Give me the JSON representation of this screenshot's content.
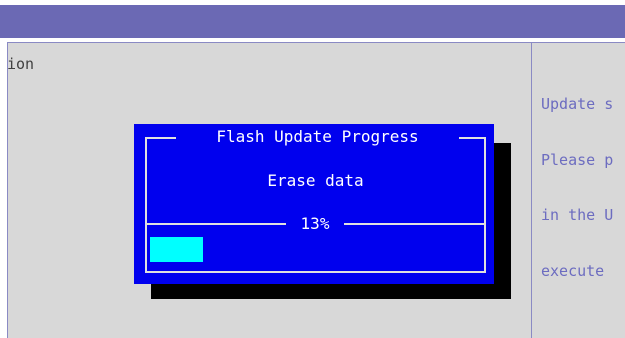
{
  "background_text": {
    "left": "ion",
    "help_lines": [
      "Update s",
      "Please p",
      "in the U",
      "execute "
    ]
  },
  "dialog": {
    "title": "Flash Update Progress",
    "message": "Erase data",
    "percent_label": "13%",
    "progress_fraction": 0.16
  },
  "colors": {
    "header_bar": "#6b69b4",
    "panel_bg": "#d8d8d8",
    "help_text": "#6c6cc0",
    "dialog_bg": "#0000ee",
    "progress_fill": "#00ffff"
  }
}
